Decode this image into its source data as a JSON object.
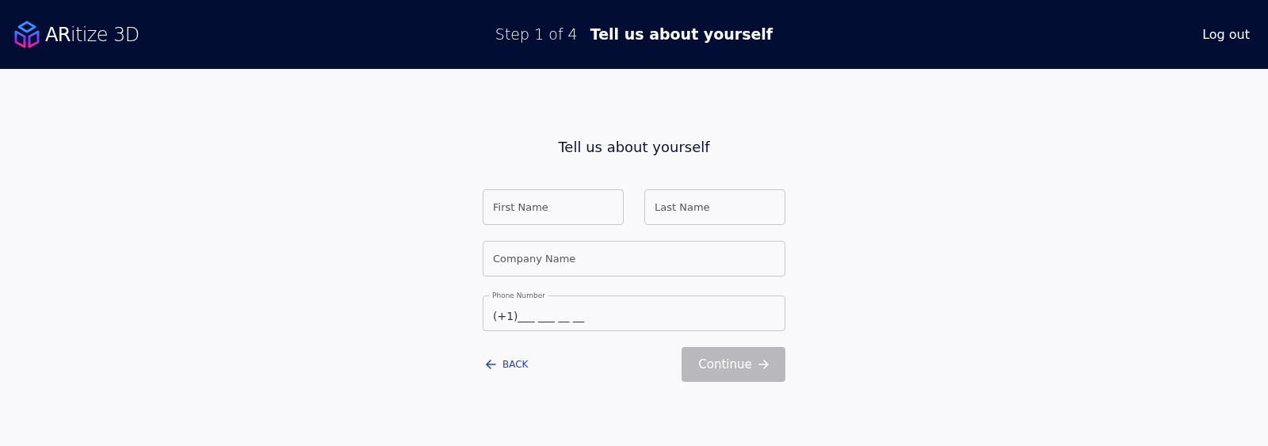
{
  "header": {
    "logo": "**AR**itize 3D",
    "step": "Step 1 of 4",
    "step_title": "Tell us about yourself",
    "logout": "Log out"
  },
  "form": {
    "title": "Tell us about yourself",
    "fields": [
      {
        "kind": "half",
        "placeholder": "First Name"
      },
      {
        "kind": "half",
        "placeholder": "Last Name"
      },
      {
        "kind": "full",
        "placeholder": "Company Name"
      },
      {
        "kind": "labeled",
        "label": "Phone Number",
        "value": "(+1)___ ___ __ __"
      }
    ],
    "back": "BACK",
    "continue": {
      "label": "Continue",
      "disabled": true
    }
  }
}
